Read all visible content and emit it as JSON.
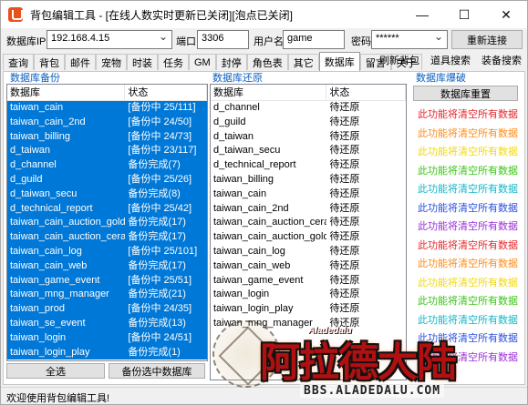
{
  "window": {
    "title": "背包编辑工具 - [在线人数实时更新已关闭][泡点已关闭]",
    "minimize": "—",
    "maximize": "☐",
    "close": "✕"
  },
  "connection": {
    "ip_label": "数据库IP",
    "ip_value": "192.168.4.15",
    "port_label": "端口",
    "port_value": "3306",
    "user_label": "用户名",
    "user_value": "game",
    "password_label": "密码",
    "password_value": "******",
    "reconnect_label": "重新连接"
  },
  "tabs": [
    "查询",
    "背包",
    "邮件",
    "宠物",
    "时装",
    "任务",
    "GM",
    "封停",
    "角色表",
    "其它",
    "数据库",
    "留言",
    "关于"
  ],
  "active_tab": "数据库",
  "right_actions": [
    "刷新背包",
    "道具搜索",
    "装备搜索"
  ],
  "backup": {
    "title": "数据库备份",
    "headers": [
      "数据库",
      "状态"
    ],
    "rows": [
      {
        "name": "taiwan_cain",
        "status": "[备份中 25/111]"
      },
      {
        "name": "taiwan_cain_2nd",
        "status": "[备份中 24/50]"
      },
      {
        "name": "taiwan_billing",
        "status": "[备份中 24/73]"
      },
      {
        "name": "d_taiwan",
        "status": "[备份中 23/117]"
      },
      {
        "name": "d_channel",
        "status": "备份完成(7)"
      },
      {
        "name": "d_guild",
        "status": "[备份中 25/26]"
      },
      {
        "name": "d_taiwan_secu",
        "status": "备份完成(8)"
      },
      {
        "name": "d_technical_report",
        "status": "[备份中 25/42]"
      },
      {
        "name": "taiwan_cain_auction_gold",
        "status": "备份完成(17)"
      },
      {
        "name": "taiwan_cain_auction_cera",
        "status": "备份完成(17)"
      },
      {
        "name": "taiwan_cain_log",
        "status": "[备份中 25/101]"
      },
      {
        "name": "taiwan_cain_web",
        "status": "备份完成(17)"
      },
      {
        "name": "taiwan_game_event",
        "status": "[备份中 25/51]"
      },
      {
        "name": "taiwan_mng_manager",
        "status": "备份完成(21)"
      },
      {
        "name": "taiwan_prod",
        "status": "[备份中 24/35]"
      },
      {
        "name": "taiwan_se_event",
        "status": "备份完成(13)"
      },
      {
        "name": "taiwan_login",
        "status": "[备份中 24/51]"
      },
      {
        "name": "taiwan_login_play",
        "status": "备份完成(1)"
      }
    ],
    "select_all_label": "全选",
    "backup_selected_label": "备份选中数据库"
  },
  "restore": {
    "title": "数据库还原",
    "headers": [
      "数据库",
      "状态"
    ],
    "rows": [
      {
        "name": "d_channel",
        "status": "待还原"
      },
      {
        "name": "d_guild",
        "status": "待还原"
      },
      {
        "name": "d_taiwan",
        "status": "待还原"
      },
      {
        "name": "d_taiwan_secu",
        "status": "待还原"
      },
      {
        "name": "d_technical_report",
        "status": "待还原"
      },
      {
        "name": "taiwan_billing",
        "status": "待还原"
      },
      {
        "name": "taiwan_cain",
        "status": "待还原"
      },
      {
        "name": "taiwan_cain_2nd",
        "status": "待还原"
      },
      {
        "name": "taiwan_cain_auction_cera",
        "status": "待还原"
      },
      {
        "name": "taiwan_cain_auction_gold",
        "status": "待还原"
      },
      {
        "name": "taiwan_cain_log",
        "status": "待还原"
      },
      {
        "name": "taiwan_cain_web",
        "status": "待还原"
      },
      {
        "name": "taiwan_game_event",
        "status": "待还原"
      },
      {
        "name": "taiwan_login",
        "status": "待还原"
      },
      {
        "name": "taiwan_login_play",
        "status": "待还原"
      },
      {
        "name": "taiwan_mng_manager",
        "status": "待还原"
      }
    ]
  },
  "explode": {
    "title": "数据库爆破",
    "reset_label": "数据库重置",
    "warning_text": "此功能将清空所有数据",
    "warning_colors": [
      "#e8262a",
      "#ff8c1a",
      "#f1d90f",
      "#3cc418",
      "#14b6c8",
      "#2a4fe0",
      "#9b2fd8",
      "#e8262a",
      "#ff8c1a",
      "#f1d90f",
      "#3cc418",
      "#14b6c8",
      "#2a4fe0",
      "#9b2fd8"
    ]
  },
  "status_bar": {
    "text": "欢迎使用背包编辑工具!"
  },
  "watermark": {
    "title": "阿拉德大陆",
    "subtitle": "Aladedalu",
    "url": "BBS.ALADEDALU.COM"
  },
  "colors": {
    "selection": "#0078d7",
    "section_title": "#0a5fc2"
  }
}
